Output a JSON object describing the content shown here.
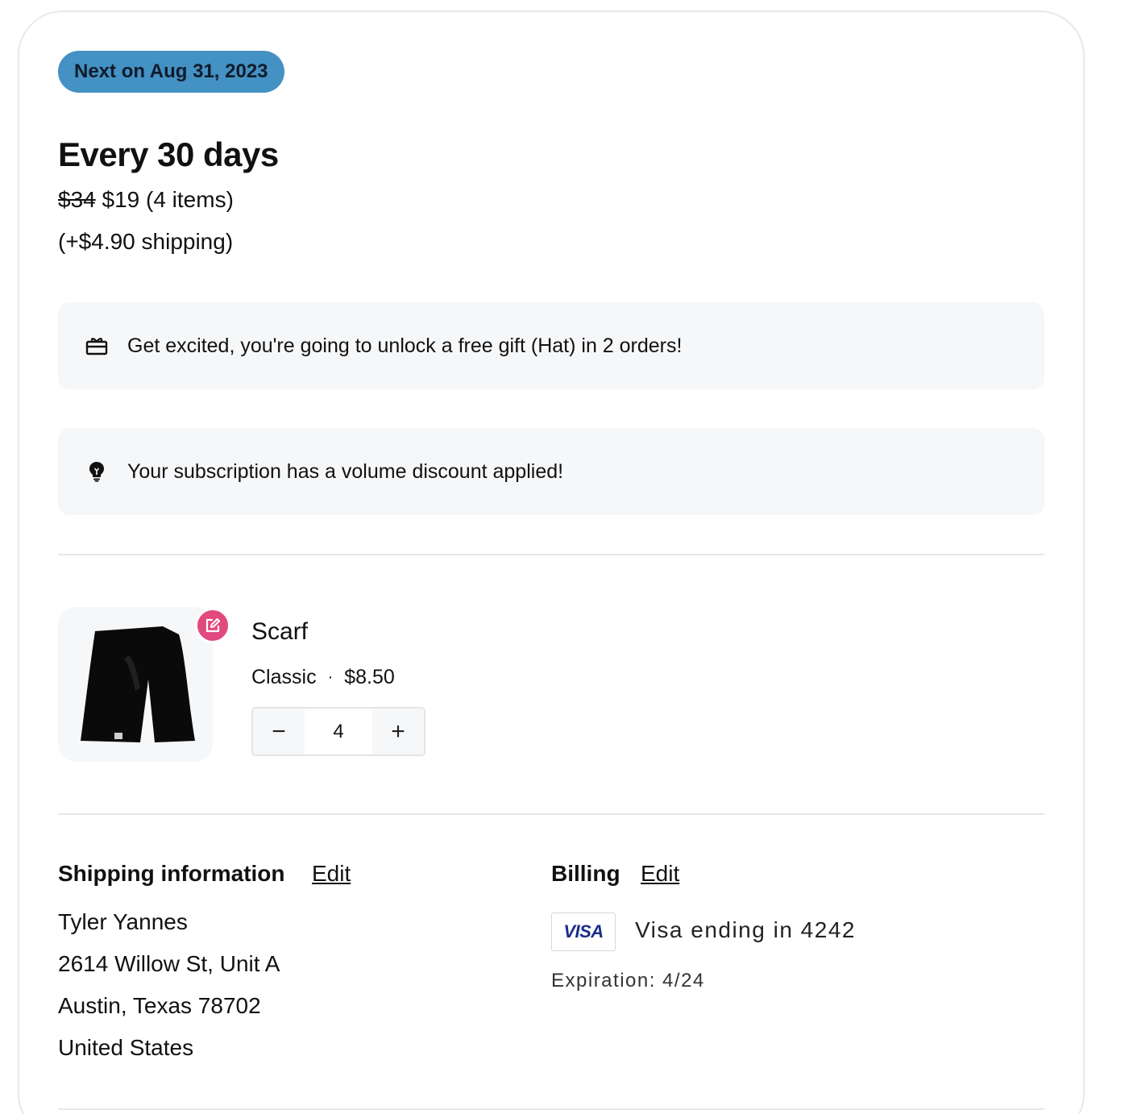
{
  "subscription": {
    "next_badge": "Next on Aug 31, 2023",
    "frequency": "Every 30 days",
    "old_price": "$34",
    "new_price_text": "$19 (4 items)",
    "shipping_text": "(+$4.90 shipping)"
  },
  "banners": {
    "gift": {
      "icon": "gift-card-icon",
      "text": "Get excited, you're going to unlock a free gift (Hat) in 2 orders!"
    },
    "discount": {
      "icon": "lightbulb-icon",
      "text": "Your subscription has a volume discount applied!"
    }
  },
  "product": {
    "name": "Scarf",
    "variant": "Classic",
    "separator": "·",
    "price": "$8.50",
    "quantity": "4",
    "image_icon": "scarf-image",
    "edit_icon": "edit-icon",
    "minus_label": "−",
    "plus_label": "+",
    "badge_color": "#e04a7f"
  },
  "shipping": {
    "title": "Shipping information",
    "edit_label": "Edit",
    "name": "Tyler Yannes",
    "street": "2614 Willow St, Unit A",
    "city_state_zip": "Austin, Texas 78702",
    "country": "United States"
  },
  "billing": {
    "title": "Billing",
    "edit_label": "Edit",
    "card_brand": "VISA",
    "card_text": "Visa ending in 4242",
    "expiration": "Expiration: 4/24"
  },
  "colors": {
    "badge_bg": "#4491c4",
    "banner_bg": "#f6f7f9",
    "visa_blue": "#1a2d8c"
  }
}
